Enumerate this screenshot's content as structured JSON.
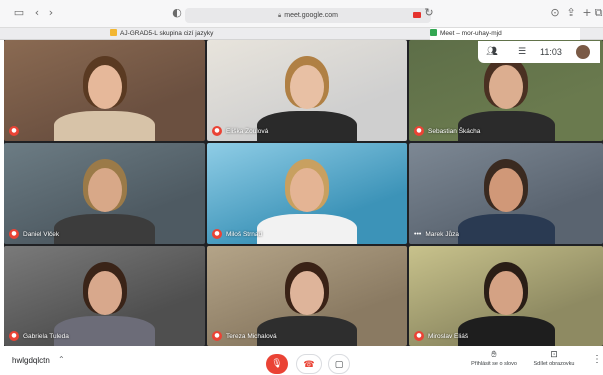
{
  "browser": {
    "url": "meet.google.com",
    "icons": [
      "sidebar-icon",
      "back-icon",
      "forward-icon",
      "shield-icon",
      "lock-icon",
      "camera-recording-icon",
      "reload-icon",
      "download-icon",
      "share-icon",
      "new-tab-icon",
      "tabs-overview-icon"
    ],
    "tabs": [
      {
        "label": "AJ-GRAD5-L skupina cizí jazyky",
        "active": false
      },
      {
        "label": "Meet – mor-uhay-mjd",
        "active": true
      }
    ]
  },
  "overlay": {
    "time": "11:03",
    "icons": [
      "people-icon",
      "chat-icon"
    ]
  },
  "participants": [
    {
      "name": "",
      "muted": true,
      "bg": "#6b5040",
      "wall": "#8a6a52",
      "hair": "#5a3a22",
      "shirt": "#d7c3a8",
      "skin": "#e6b89a"
    },
    {
      "name": "Eliška Zoulová",
      "muted": true,
      "bg": "#cfcfcf",
      "wall": "#e8e4dc",
      "hair": "#b08044",
      "shirt": "#2a2a2a",
      "skin": "#e8c0a4"
    },
    {
      "name": "Sebastian Škácha",
      "muted": true,
      "bg": "#6a7a4e",
      "wall": "#5d6e48",
      "hair": "#4a3022",
      "shirt": "#2b2b2b",
      "skin": "#dcae90"
    },
    {
      "name": "Daniel Vlček",
      "muted": true,
      "bg": "#4e5a62",
      "wall": "#6c7c84",
      "hair": "#9b7a48",
      "shirt": "#3c3c3c",
      "skin": "#d8a888"
    },
    {
      "name": "Miloš Strnad",
      "muted": true,
      "bg": "#3c93b8",
      "wall": "#8fcde6",
      "hair": "#c8a060",
      "shirt": "#f2f2f2",
      "skin": "#e4b494"
    },
    {
      "name": "Marek Jůza",
      "muted": false,
      "bg": "#5a6470",
      "wall": "#7d8894",
      "hair": "#3a2a20",
      "shirt": "#2a3a52",
      "skin": "#d09878"
    },
    {
      "name": "Gabriela Tuleda",
      "muted": true,
      "bg": "#4f4f4f",
      "wall": "#7a7a7a",
      "hair": "#3a2418",
      "shirt": "#6c6c78",
      "skin": "#d8a88c"
    },
    {
      "name": "Tereza Michalová",
      "muted": true,
      "bg": "#8a7a62",
      "wall": "#b4a488",
      "hair": "#3a2216",
      "shirt": "#2e2e2e",
      "skin": "#deb49a"
    },
    {
      "name": "Miroslav Eliáš",
      "muted": true,
      "bg": "#8e8a62",
      "wall": "#c8c28c",
      "hair": "#2a1e16",
      "shirt": "#1e1e1e",
      "skin": "#d4a284"
    }
  ],
  "footer": {
    "meeting_code": "hwlgdqlctn",
    "raise_hand": "Přihlásit se o slovo",
    "present": "Sdílet obrazovku",
    "mic_color": "#ea4335"
  }
}
